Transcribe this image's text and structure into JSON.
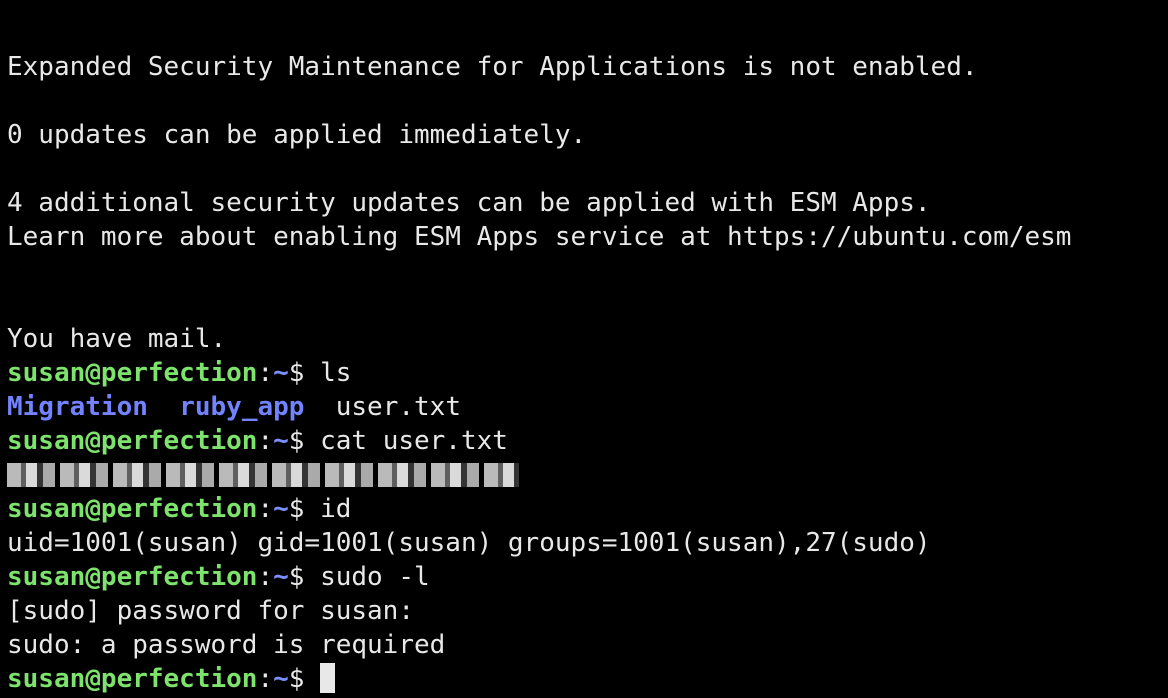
{
  "terminal": {
    "motd_esm": "Expanded Security Maintenance for Applications is not enabled.",
    "motd_updates": "0 updates can be applied immediately.",
    "motd_security": "4 additional security updates can be applied with ESM Apps.",
    "motd_learn": "Learn more about enabling ESM Apps service at https://ubuntu.com/esm",
    "mail": "You have mail.",
    "prompt": {
      "user_host": "susan@perfection",
      "sep": ":",
      "path": "~",
      "symbol": "$ "
    },
    "commands": {
      "ls": "ls",
      "cat": "cat user.txt",
      "id": "id",
      "sudo": "sudo -l"
    },
    "ls_output": {
      "dir1": "Migration",
      "dir2": "ruby_app",
      "file1": "user.txt"
    },
    "id_output": "uid=1001(susan) gid=1001(susan) groups=1001(susan),27(sudo)",
    "sudo_prompt": "[sudo] password for susan:",
    "sudo_error": "sudo: a password is required"
  },
  "colors": {
    "background": "#000000",
    "text": "#e8e8e8",
    "prompt_user": "#7ee36c",
    "prompt_path": "#7b8fff",
    "directory": "#7383ff"
  }
}
